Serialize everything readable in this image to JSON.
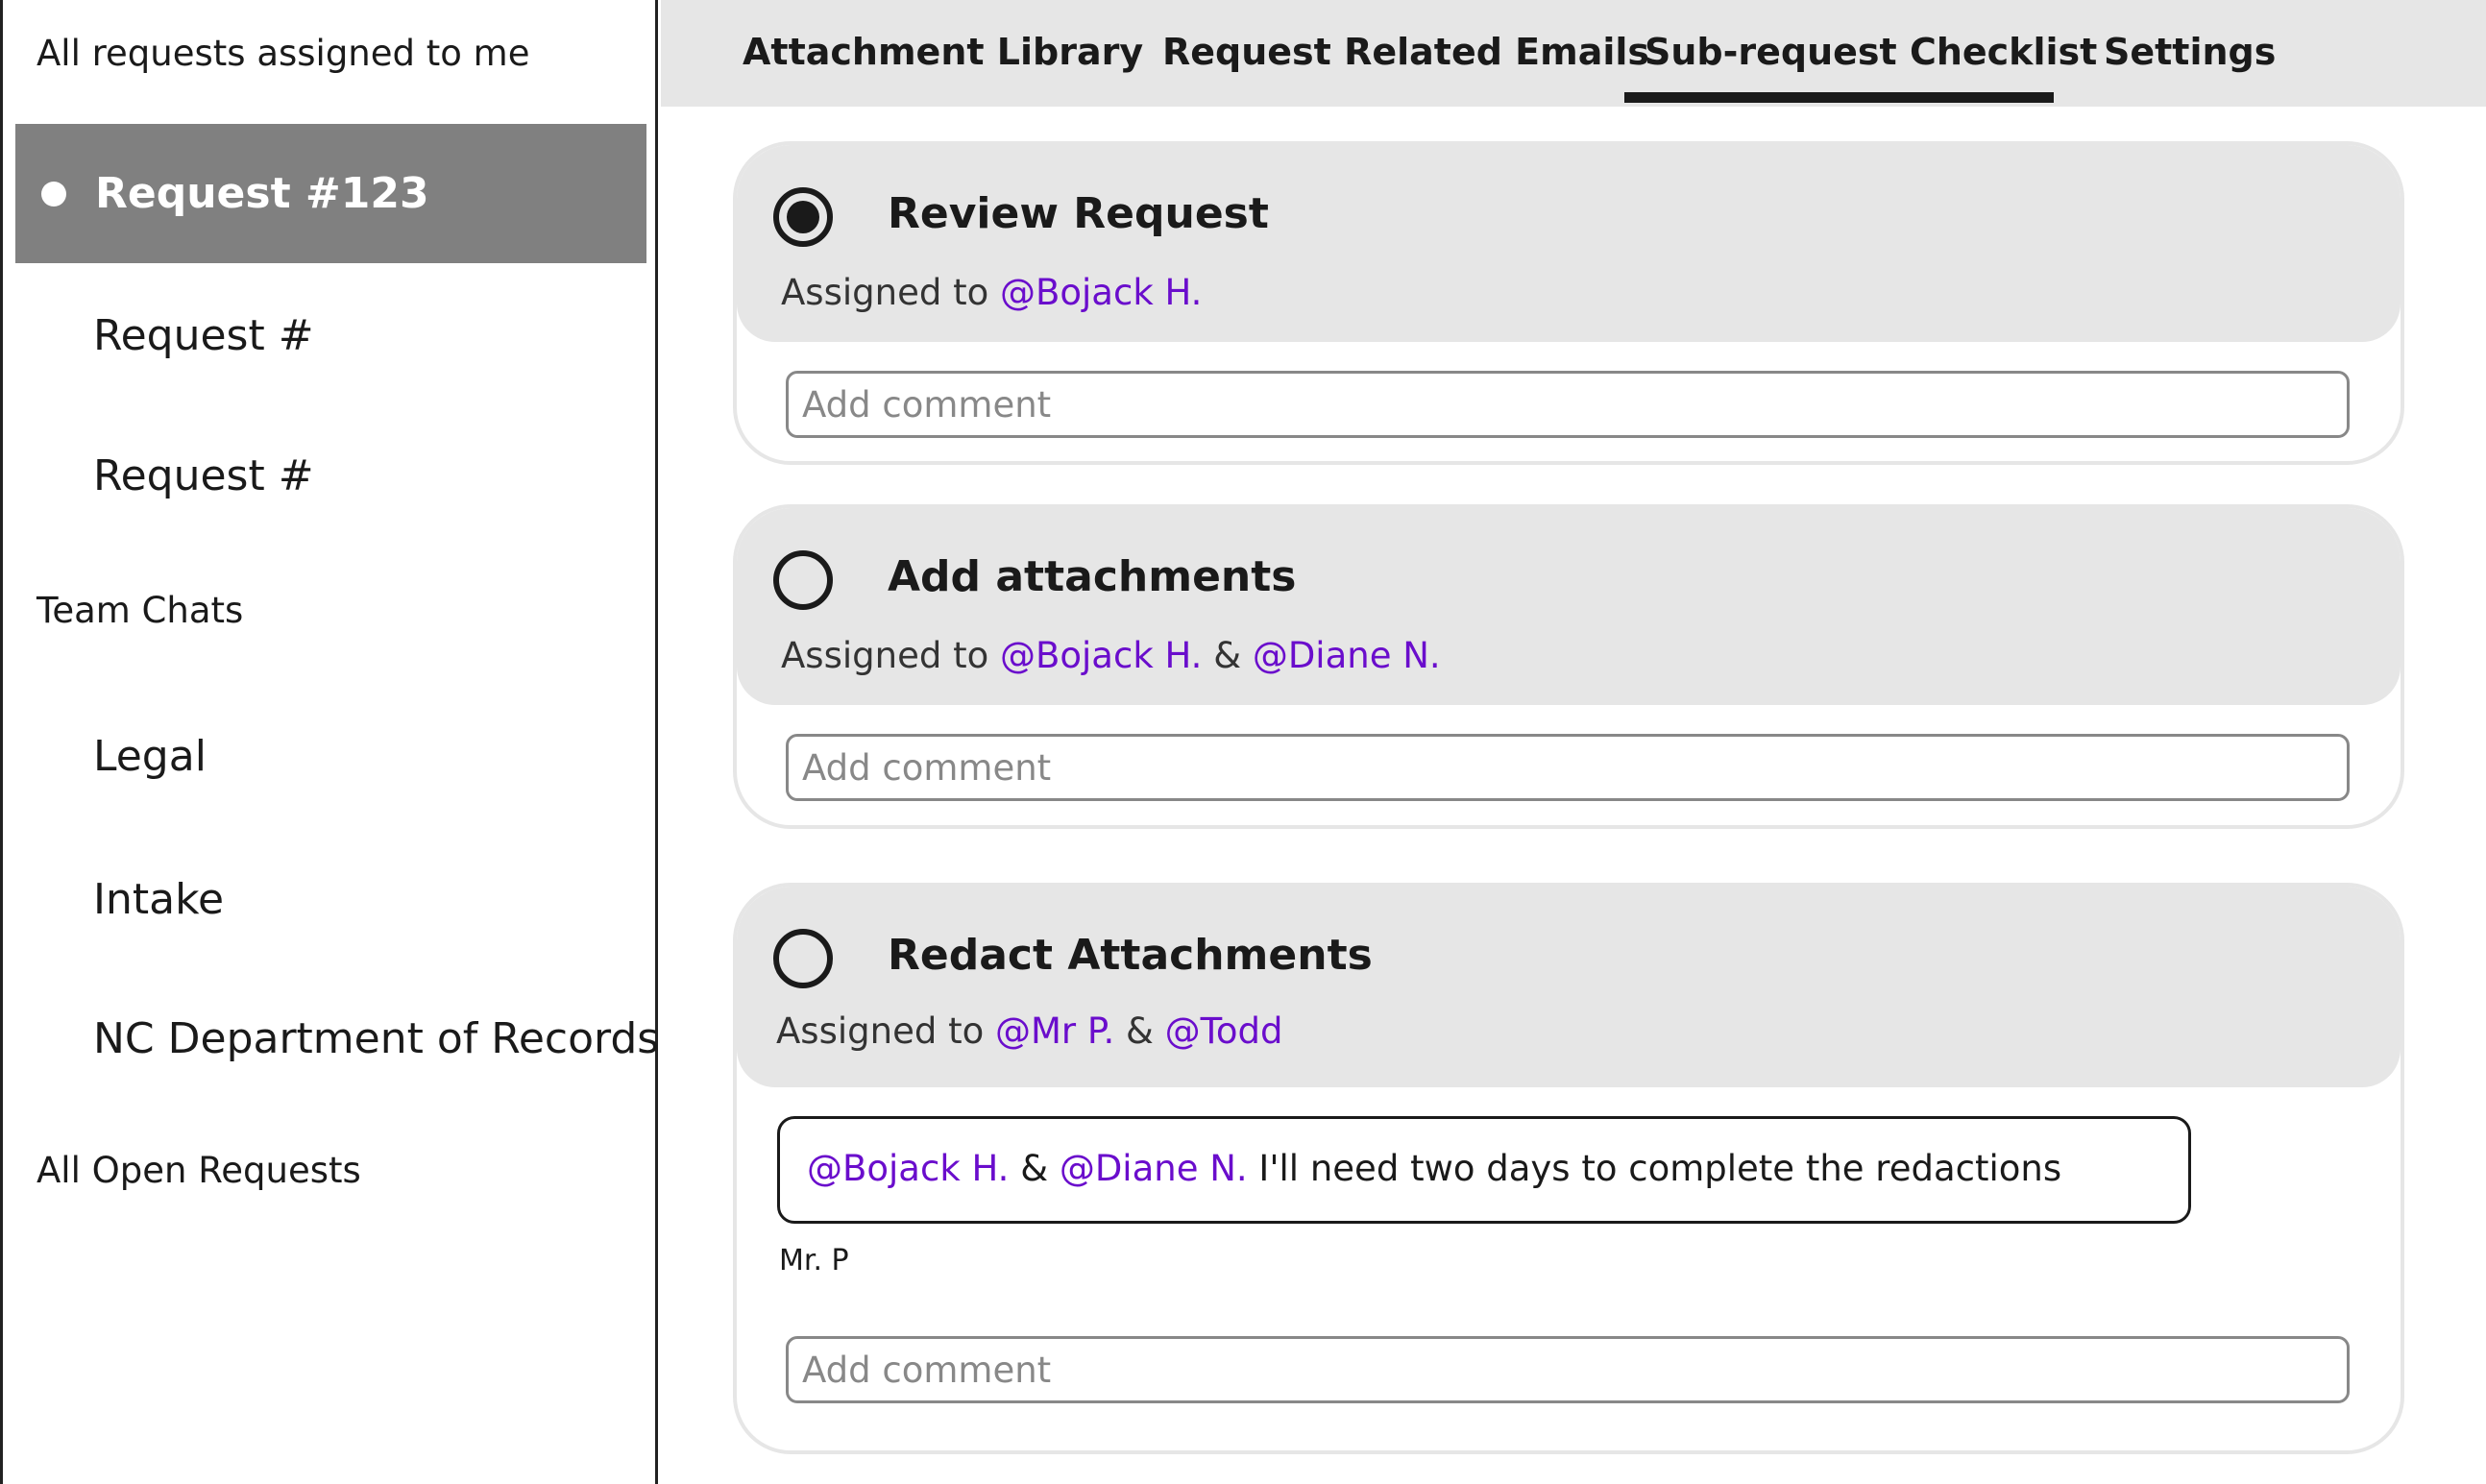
{
  "sidebar": {
    "section_assigned": "All requests assigned to me",
    "requests": [
      {
        "label": "Request #123",
        "active": true
      },
      {
        "label": "Request #"
      },
      {
        "label": "Request #"
      }
    ],
    "section_chats": "Team Chats",
    "chats": [
      "Legal",
      "Intake",
      "NC Department of Records"
    ],
    "section_open": "All Open Requests"
  },
  "tabs": [
    {
      "label": "Attachment Library"
    },
    {
      "label": "Request Related Emails"
    },
    {
      "label": "Sub-request Checklist",
      "active": true
    },
    {
      "label": "Settings"
    }
  ],
  "common": {
    "assigned_prefix": "Assigned to ",
    "joiner": " & ",
    "comment_placeholder": "Add comment"
  },
  "tasks": [
    {
      "title": "Review Request",
      "checked": true,
      "assignees": [
        "@Bojack H."
      ]
    },
    {
      "title": "Add attachments",
      "checked": false,
      "assignees": [
        "@Bojack H.",
        "@Diane N."
      ]
    },
    {
      "title": "Redact Attachments",
      "checked": false,
      "assignees": [
        "@Mr P.",
        "@Todd"
      ],
      "comment": {
        "mentions": [
          "@Bojack H.",
          "@Diane N."
        ],
        "text": " I'll need two days to complete the redactions",
        "author": "Mr. P"
      }
    }
  ],
  "colors": {
    "mention": "#6a0dcc",
    "active_sidebar_bg": "#808080",
    "card_header_bg": "#e6e6e6"
  }
}
